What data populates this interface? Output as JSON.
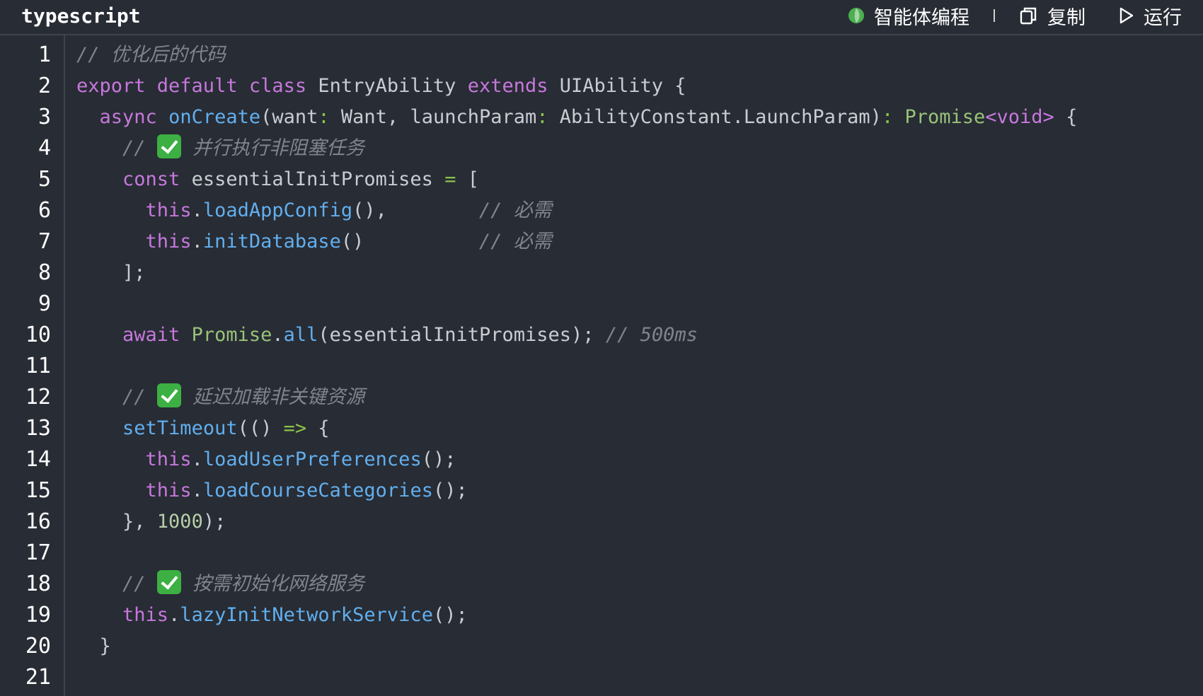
{
  "header": {
    "language": "typescript",
    "actions": [
      {
        "label": "智能体编程",
        "icon": "agent-leaf-icon"
      },
      {
        "label": "复制",
        "icon": "copy-icon"
      },
      {
        "label": "运行",
        "icon": "play-icon"
      }
    ]
  },
  "colors": {
    "background": "#282c34",
    "keyword": "#c678dd",
    "function": "#61afef",
    "type": "#98c379",
    "comment": "#7f848e",
    "number": "#b5cea8",
    "text": "#c9ccd2"
  },
  "code": {
    "line_numbers": [
      "1",
      "2",
      "3",
      "4",
      "5",
      "6",
      "7",
      "8",
      "9",
      "10",
      "11",
      "12",
      "13",
      "14",
      "15",
      "16",
      "17",
      "18",
      "19",
      "20",
      "21"
    ],
    "lines": [
      [
        {
          "t": "cm",
          "v": "// 优化后的代码"
        }
      ],
      [
        {
          "t": "kw",
          "v": "export default class"
        },
        {
          "t": "pl",
          "v": " EntryAbility "
        },
        {
          "t": "kw",
          "v": "extends"
        },
        {
          "t": "pl",
          "v": " UIAbility {"
        }
      ],
      [
        {
          "t": "pl",
          "v": "  "
        },
        {
          "t": "kw",
          "v": "async"
        },
        {
          "t": "pl",
          "v": " "
        },
        {
          "t": "fn",
          "v": "onCreate"
        },
        {
          "t": "pl",
          "v": "(want"
        },
        {
          "t": "op",
          "v": ":"
        },
        {
          "t": "pl",
          "v": " Want, launchParam"
        },
        {
          "t": "op",
          "v": ":"
        },
        {
          "t": "pl",
          "v": " AbilityConstant.LaunchParam)"
        },
        {
          "t": "op",
          "v": ":"
        },
        {
          "t": "pl",
          "v": " "
        },
        {
          "t": "ty",
          "v": "Promise"
        },
        {
          "t": "kw",
          "v": "<void>"
        },
        {
          "t": "pl",
          "v": " {"
        }
      ],
      [
        {
          "t": "pl",
          "v": "    "
        },
        {
          "t": "cm",
          "v": "// "
        },
        {
          "t": "check",
          "v": "✅"
        },
        {
          "t": "cm",
          "v": " 并行执行非阻塞任务"
        }
      ],
      [
        {
          "t": "pl",
          "v": "    "
        },
        {
          "t": "kw",
          "v": "const"
        },
        {
          "t": "pl",
          "v": " essentialInitPromises "
        },
        {
          "t": "op",
          "v": "="
        },
        {
          "t": "pl",
          "v": " ["
        }
      ],
      [
        {
          "t": "pl",
          "v": "      "
        },
        {
          "t": "kw",
          "v": "this"
        },
        {
          "t": "pl",
          "v": "."
        },
        {
          "t": "fn",
          "v": "loadAppConfig"
        },
        {
          "t": "pl",
          "v": "(),        "
        },
        {
          "t": "cm",
          "v": "// 必需"
        }
      ],
      [
        {
          "t": "pl",
          "v": "      "
        },
        {
          "t": "kw",
          "v": "this"
        },
        {
          "t": "pl",
          "v": "."
        },
        {
          "t": "fn",
          "v": "initDatabase"
        },
        {
          "t": "pl",
          "v": "()          "
        },
        {
          "t": "cm",
          "v": "// 必需"
        }
      ],
      [
        {
          "t": "pl",
          "v": "    ];"
        }
      ],
      [],
      [
        {
          "t": "pl",
          "v": "    "
        },
        {
          "t": "kw",
          "v": "await"
        },
        {
          "t": "pl",
          "v": " "
        },
        {
          "t": "ty",
          "v": "Promise"
        },
        {
          "t": "pl",
          "v": "."
        },
        {
          "t": "fn",
          "v": "all"
        },
        {
          "t": "pl",
          "v": "(essentialInitPromises); "
        },
        {
          "t": "cm",
          "v": "// 500ms"
        }
      ],
      [],
      [
        {
          "t": "pl",
          "v": "    "
        },
        {
          "t": "cm",
          "v": "// "
        },
        {
          "t": "check",
          "v": "✅"
        },
        {
          "t": "cm",
          "v": " 延迟加载非关键资源"
        }
      ],
      [
        {
          "t": "pl",
          "v": "    "
        },
        {
          "t": "fn",
          "v": "setTimeout"
        },
        {
          "t": "pl",
          "v": "(() "
        },
        {
          "t": "op",
          "v": "=>"
        },
        {
          "t": "pl",
          "v": " {"
        }
      ],
      [
        {
          "t": "pl",
          "v": "      "
        },
        {
          "t": "kw",
          "v": "this"
        },
        {
          "t": "pl",
          "v": "."
        },
        {
          "t": "fn",
          "v": "loadUserPreferences"
        },
        {
          "t": "pl",
          "v": "();"
        }
      ],
      [
        {
          "t": "pl",
          "v": "      "
        },
        {
          "t": "kw",
          "v": "this"
        },
        {
          "t": "pl",
          "v": "."
        },
        {
          "t": "fn",
          "v": "loadCourseCategories"
        },
        {
          "t": "pl",
          "v": "();"
        }
      ],
      [
        {
          "t": "pl",
          "v": "    }, "
        },
        {
          "t": "num",
          "v": "1000"
        },
        {
          "t": "pl",
          "v": ");"
        }
      ],
      [],
      [
        {
          "t": "pl",
          "v": "    "
        },
        {
          "t": "cm",
          "v": "// "
        },
        {
          "t": "check",
          "v": "✅"
        },
        {
          "t": "cm",
          "v": " 按需初始化网络服务"
        }
      ],
      [
        {
          "t": "pl",
          "v": "    "
        },
        {
          "t": "kw",
          "v": "this"
        },
        {
          "t": "pl",
          "v": "."
        },
        {
          "t": "fn",
          "v": "lazyInitNetworkService"
        },
        {
          "t": "pl",
          "v": "();"
        }
      ],
      [
        {
          "t": "pl",
          "v": "  }"
        }
      ],
      []
    ]
  }
}
